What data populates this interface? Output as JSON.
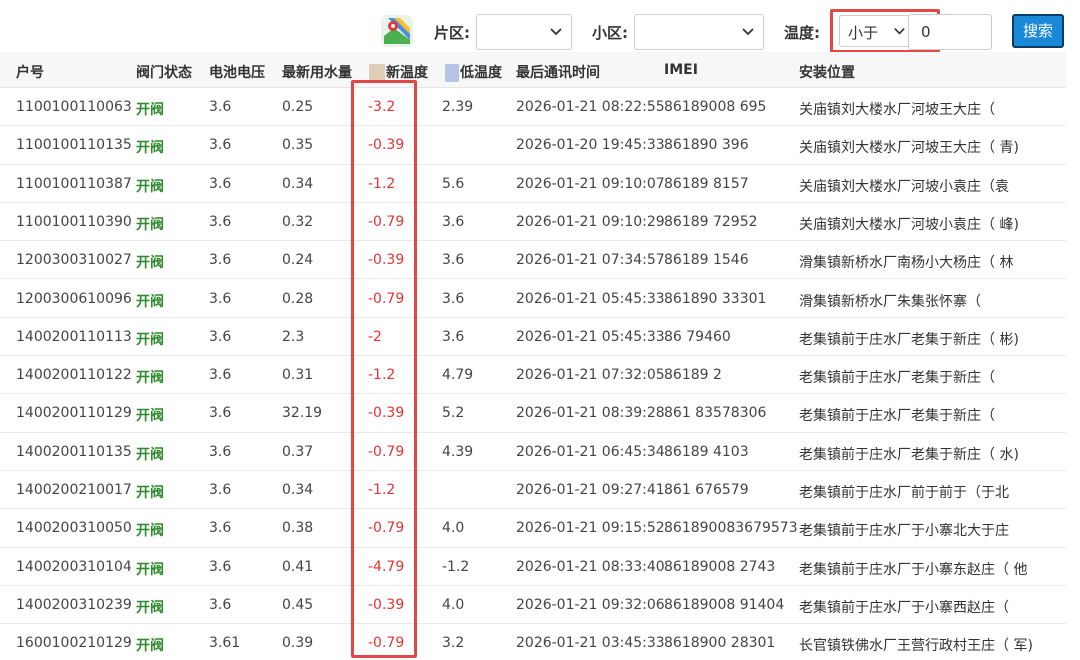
{
  "filters": {
    "area_label": "片区:",
    "area_value": "",
    "community_label": "小区:",
    "community_value": "",
    "temp_label": "温度:",
    "temp_operator": "小于",
    "temp_value": "0",
    "search_label": "搜索"
  },
  "table": {
    "headers": {
      "account": "户号",
      "valve_status": "阀门状态",
      "battery_voltage": "电池电压",
      "latest_water": "最新用水量",
      "latest_temp": "新温度",
      "min_temp": "低温度",
      "last_comm": "最后通讯时间",
      "imei": "IMEI",
      "location": "安装位置"
    },
    "rows": [
      {
        "account": "1100100110063",
        "valve": "开阀",
        "voltage": "3.6",
        "water": "0.25",
        "temp": "-3.2",
        "min_temp": "2.39",
        "time": "2026-01-21 08:22:55",
        "imei": "86189008 695",
        "loc": "关庙镇刘大楼水厂河坡王大庄（"
      },
      {
        "account": "1100100110135",
        "valve": "开阀",
        "voltage": "3.6",
        "water": "0.35",
        "temp": "-0.39",
        "min_temp": "",
        "time": "2026-01-20 19:45:33",
        "imei": "861890 396",
        "loc": "关庙镇刘大楼水厂河坡王大庄（ 青)"
      },
      {
        "account": "1100100110387",
        "valve": "开阀",
        "voltage": "3.6",
        "water": "0.34",
        "temp": "-1.2",
        "min_temp": "5.6",
        "time": "2026-01-21 09:10:07",
        "imei": "86189 8157",
        "loc": "关庙镇刘大楼水厂河坡小袁庄（袁"
      },
      {
        "account": "1100100110390",
        "valve": "开阀",
        "voltage": "3.6",
        "water": "0.32",
        "temp": "-0.79",
        "min_temp": "3.6",
        "time": "2026-01-21 09:10:29",
        "imei": "86189 72952",
        "loc": "关庙镇刘大楼水厂河坡小袁庄（ 峰)"
      },
      {
        "account": "1200300310027",
        "valve": "开阀",
        "voltage": "3.6",
        "water": "0.24",
        "temp": "-0.39",
        "min_temp": "3.6",
        "time": "2026-01-21 07:34:57",
        "imei": "86189 1546",
        "loc": "滑集镇新桥水厂南杨小大杨庄（ 林"
      },
      {
        "account": "1200300610096",
        "valve": "开阀",
        "voltage": "3.6",
        "water": "0.28",
        "temp": "-0.79",
        "min_temp": "3.6",
        "time": "2026-01-21 05:45:33",
        "imei": "861890 33301",
        "loc": "滑集镇新桥水厂朱集张怀寨（"
      },
      {
        "account": "1400200110113",
        "valve": "开阀",
        "voltage": "3.6",
        "water": "2.3",
        "temp": "-2",
        "min_temp": "3.6",
        "time": "2026-01-21 05:45:33",
        "imei": "86 79460",
        "loc": "老集镇前于庄水厂老集于新庄（ 彬)"
      },
      {
        "account": "1400200110122",
        "valve": "开阀",
        "voltage": "3.6",
        "water": "0.31",
        "temp": "-1.2",
        "min_temp": "4.79",
        "time": "2026-01-21 07:32:05",
        "imei": "86189 2",
        "loc": "老集镇前于庄水厂老集于新庄（"
      },
      {
        "account": "1400200110129",
        "valve": "开阀",
        "voltage": "3.6",
        "water": "32.19",
        "temp": "-0.39",
        "min_temp": "5.2",
        "time": "2026-01-21 08:39:28",
        "imei": "861 83578306",
        "loc": "老集镇前于庄水厂老集于新庄（"
      },
      {
        "account": "1400200110135",
        "valve": "开阀",
        "voltage": "3.6",
        "water": "0.37",
        "temp": "-0.79",
        "min_temp": "4.39",
        "time": "2026-01-21 06:45:34",
        "imei": "86189 4103",
        "loc": "老集镇前于庄水厂老集于新庄（ 水)"
      },
      {
        "account": "1400200210017",
        "valve": "开阀",
        "voltage": "3.6",
        "water": "0.34",
        "temp": "-1.2",
        "min_temp": "",
        "time": "2026-01-21 09:27:41",
        "imei": "861 676579",
        "loc": "老集镇前于庄水厂前于前于（于北"
      },
      {
        "account": "1400200310050",
        "valve": "开阀",
        "voltage": "3.6",
        "water": "0.38",
        "temp": "-0.79",
        "min_temp": "4.0",
        "time": "2026-01-21 09:15:52",
        "imei": "861890083679573",
        "loc": "老集镇前于庄水厂于小寨北大于庄"
      },
      {
        "account": "1400200310104",
        "valve": "开阀",
        "voltage": "3.6",
        "water": "0.41",
        "temp": "-4.79",
        "min_temp": "-1.2",
        "time": "2026-01-21 08:33:40",
        "imei": "86189008 2743",
        "loc": "老集镇前于庄水厂于小寨东赵庄（ 他"
      },
      {
        "account": "1400200310239",
        "valve": "开阀",
        "voltage": "3.6",
        "water": "0.45",
        "temp": "-0.39",
        "min_temp": "4.0",
        "time": "2026-01-21 09:32:06",
        "imei": "86189008 91404",
        "loc": "老集镇前于庄水厂于小寨西赵庄（"
      },
      {
        "account": "1600100210129",
        "valve": "开阀",
        "voltage": "3.61",
        "water": "0.39",
        "temp": "-0.79",
        "min_temp": "3.2",
        "time": "2026-01-21 03:45:33",
        "imei": "8618900 28301",
        "loc": "长官镇铁佛水厂王营行政村王庄（ 军)"
      }
    ]
  }
}
